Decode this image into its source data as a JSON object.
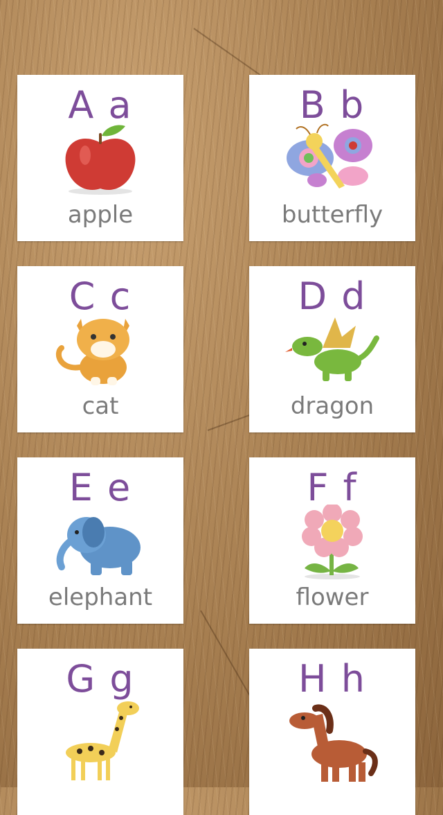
{
  "cards": [
    {
      "letters": "A a",
      "word": "apple",
      "icon": "apple-icon"
    },
    {
      "letters": "B b",
      "word": "butterfly",
      "icon": "butterfly-icon"
    },
    {
      "letters": "C c",
      "word": "cat",
      "icon": "cat-icon"
    },
    {
      "letters": "D d",
      "word": "dragon",
      "icon": "dragon-icon"
    },
    {
      "letters": "E e",
      "word": "elephant",
      "icon": "elephant-icon"
    },
    {
      "letters": "F f",
      "word": "flower",
      "icon": "flower-icon"
    },
    {
      "letters": "G g",
      "word": "",
      "icon": "giraffe-icon"
    },
    {
      "letters": "H h",
      "word": "",
      "icon": "horse-icon"
    }
  ],
  "colors": {
    "letter": "#7d4d9a",
    "word": "#7a7a7a",
    "card_bg": "#ffffff",
    "wood_bg": "#a77f51"
  }
}
